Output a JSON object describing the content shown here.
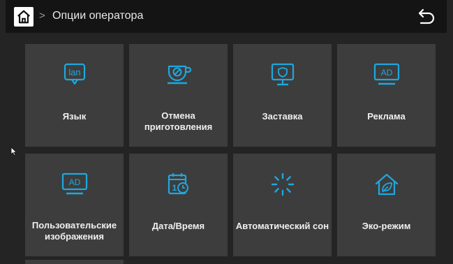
{
  "header": {
    "home_icon": "home-icon",
    "separator": ">",
    "title": "Опции оператора",
    "back_icon": "back-arrow-icon"
  },
  "colors": {
    "accent": "#1ea8e0",
    "tile": "#3d3d3d",
    "background": "#242424",
    "topbar": "#141414"
  },
  "tiles": [
    {
      "label": "Язык",
      "icon": "language-lan-icon"
    },
    {
      "label": "Отмена\nприготовления",
      "icon": "cancel-cup-icon"
    },
    {
      "label": "Заставка",
      "icon": "screensaver-monitor-icon"
    },
    {
      "label": "Реклама",
      "icon": "ad-monitor-icon"
    },
    {
      "label": "Пользовательские\nизображения",
      "icon": "ad-monitor-icon"
    },
    {
      "label": "Дата/Время",
      "icon": "calendar-clock-icon"
    },
    {
      "label": "Автоматический сон",
      "icon": "loading-spinner-icon"
    },
    {
      "label": "Эко-режим",
      "icon": "eco-house-leaf-icon"
    }
  ]
}
